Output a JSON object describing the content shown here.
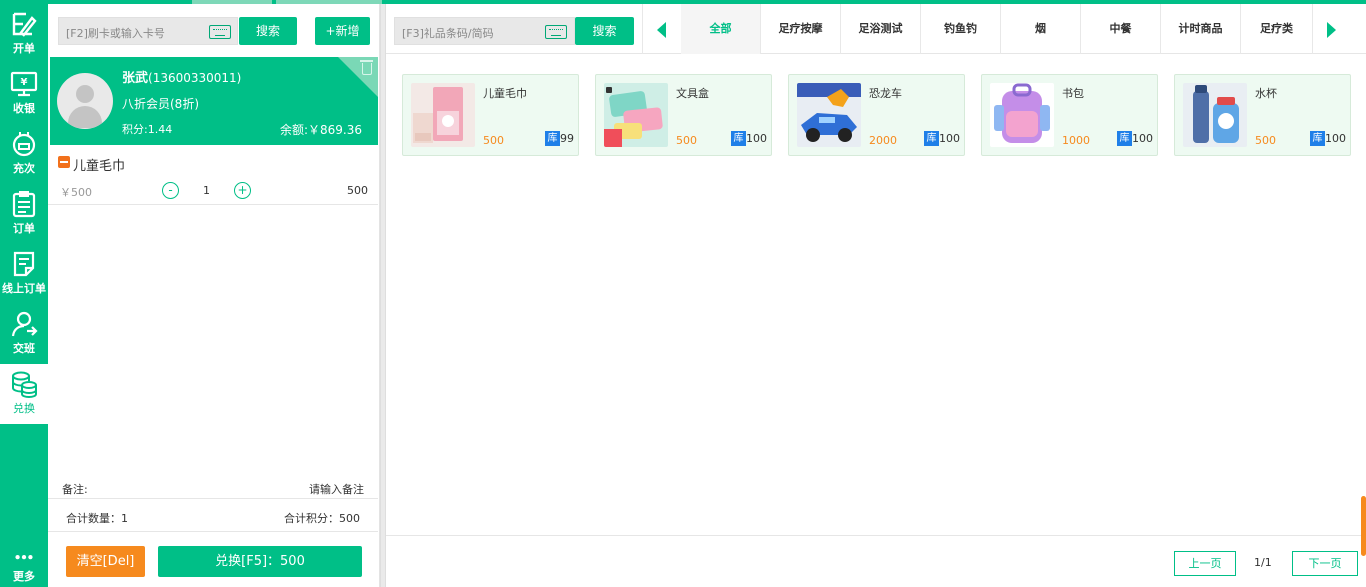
{
  "sidebar": {
    "items": [
      {
        "label": "开单",
        "icon": "edit-icon"
      },
      {
        "label": "收银",
        "icon": "cashier-icon"
      },
      {
        "label": "充次",
        "icon": "recharge-icon"
      },
      {
        "label": "订单",
        "icon": "order-icon"
      },
      {
        "label": "线上订单",
        "icon": "online-order-icon"
      },
      {
        "label": "交班",
        "icon": "shift-icon"
      },
      {
        "label": "兑换",
        "icon": "exchange-icon"
      },
      {
        "label": "更多",
        "icon": "more-icon"
      }
    ]
  },
  "member_search": {
    "placeholder": "[F2]刷卡或输入卡号",
    "search_label": "搜索",
    "add_label": "+新增"
  },
  "member": {
    "name": "张武",
    "phone": "(13600330011)",
    "level": "八折会员(8折)",
    "points": "积分:1.44",
    "balance": "余额:￥869.36"
  },
  "cart": {
    "items": [
      {
        "name": "儿童毛巾",
        "price": "￥500",
        "qty": "1",
        "subtotal": "500",
        "minus": "-",
        "plus": "+"
      }
    ],
    "remark_label": "备注:",
    "remark_placeholder": "请输入备注",
    "total_qty": "合计数量：1",
    "total_points": "合计积分：500",
    "clear_label": "清空[Del]",
    "exchange_label": "兑换[F5]：500"
  },
  "product_search": {
    "placeholder": "[F3]礼品条码/简码",
    "search_label": "搜索"
  },
  "tabs": [
    "全部",
    "足疗按摩",
    "足浴测试",
    "钓鱼钓",
    "烟",
    "中餐",
    "计时商品",
    "足疗类"
  ],
  "products": [
    {
      "name": "儿童毛巾",
      "points": "500",
      "stock_tag": "库",
      "stock": "99"
    },
    {
      "name": "文具盒",
      "points": "500",
      "stock_tag": "库",
      "stock": "100"
    },
    {
      "name": "恐龙车",
      "points": "2000",
      "stock_tag": "库",
      "stock": "100"
    },
    {
      "name": "书包",
      "points": "1000",
      "stock_tag": "库",
      "stock": "100"
    },
    {
      "name": "水杯",
      "points": "500",
      "stock_tag": "库",
      "stock": "100"
    }
  ],
  "pagination": {
    "prev": "上一页",
    "info": "1/1",
    "next": "下一页"
  },
  "colors": {
    "primary": "#00bf87",
    "orange": "#f68a1e",
    "stock_blue": "#1f7fe8"
  }
}
